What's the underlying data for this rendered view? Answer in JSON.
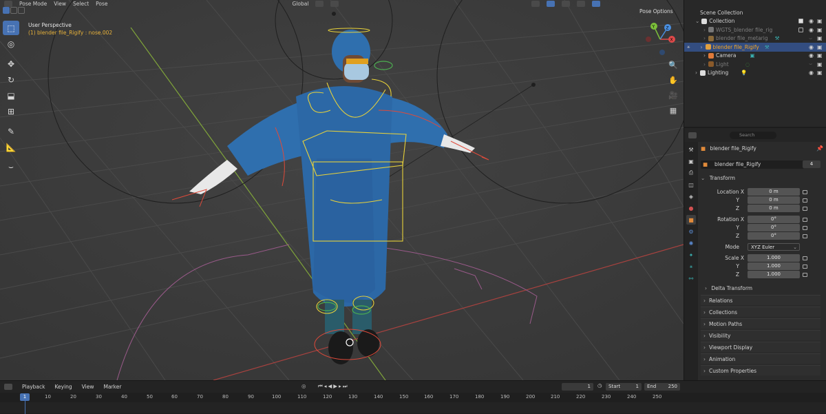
{
  "viewport": {
    "header": {
      "mode": "Pose Mode",
      "menus": [
        "View",
        "Select",
        "Pose"
      ],
      "orientation": "Global",
      "pose_options": "Pose Options"
    },
    "overlay": {
      "perspective": "User Perspective",
      "active_object": "(1) blender file_Rigify : nose.002"
    },
    "tools": [
      "select-box",
      "cursor",
      "move",
      "rotate",
      "scale",
      "transform",
      "annotate",
      "measure",
      "bone-tool"
    ],
    "gizmo_axes": [
      "X",
      "Y",
      "Z"
    ]
  },
  "outliner": {
    "search_placeholder": "Search",
    "items": [
      {
        "label": "Scene Collection",
        "level": 0,
        "icon": "scene-collection-icon"
      },
      {
        "label": "Collection",
        "level": 1,
        "icon": "collection-icon"
      },
      {
        "label": "WGTS_blender file_rig",
        "level": 2,
        "icon": "collection-icon",
        "dim": true
      },
      {
        "label": "blender file_metarig",
        "level": 2,
        "icon": "armature-icon",
        "dim": true
      },
      {
        "label": "blender file_Rigify",
        "level": 2,
        "icon": "armature-icon",
        "selected": true
      },
      {
        "label": "Camera",
        "level": 2,
        "icon": "camera-icon"
      },
      {
        "label": "Light",
        "level": 2,
        "icon": "light-icon",
        "dim": true
      },
      {
        "label": "Lighting",
        "level": 1,
        "icon": "collection-icon"
      }
    ]
  },
  "properties": {
    "search_placeholder": "Search",
    "object_name": "blender file_Rigify",
    "data_name": "blender file_Rigify",
    "users": "4",
    "transform": {
      "title": "Transform",
      "location_label": "Location X",
      "location": [
        "0 m",
        "0 m",
        "0 m"
      ],
      "rotation_label": "Rotation X",
      "rotation": [
        "0°",
        "0°",
        "0°"
      ],
      "mode_label": "Mode",
      "mode": "XYZ Euler",
      "scale_label": "Scale X",
      "scale": [
        "1.000",
        "1.000",
        "1.000"
      ],
      "y_label": "Y",
      "z_label": "Z"
    },
    "panels": [
      "Delta Transform",
      "Relations",
      "Collections",
      "Motion Paths",
      "Visibility",
      "Viewport Display",
      "Animation",
      "Custom Properties"
    ]
  },
  "timeline": {
    "menus": [
      "Playback",
      "Keying",
      "View",
      "Marker"
    ],
    "current_frame": "1",
    "start_label": "Start",
    "start": "1",
    "end_label": "End",
    "end": "250",
    "ticks": [
      "1",
      "10",
      "20",
      "30",
      "40",
      "50",
      "60",
      "70",
      "80",
      "90",
      "100",
      "110",
      "120",
      "130",
      "140",
      "150",
      "160",
      "170",
      "180",
      "190",
      "200",
      "210",
      "220",
      "230",
      "240",
      "250"
    ],
    "cursor_frame": "1"
  },
  "colors": {
    "accent": "#4772b3",
    "selected_text": "#f5a623",
    "viewport_bg": "#3c3c3c",
    "bone_yellow": "#e8d23a",
    "bone_red": "#e04a3a",
    "gown": "#2f6fae"
  }
}
